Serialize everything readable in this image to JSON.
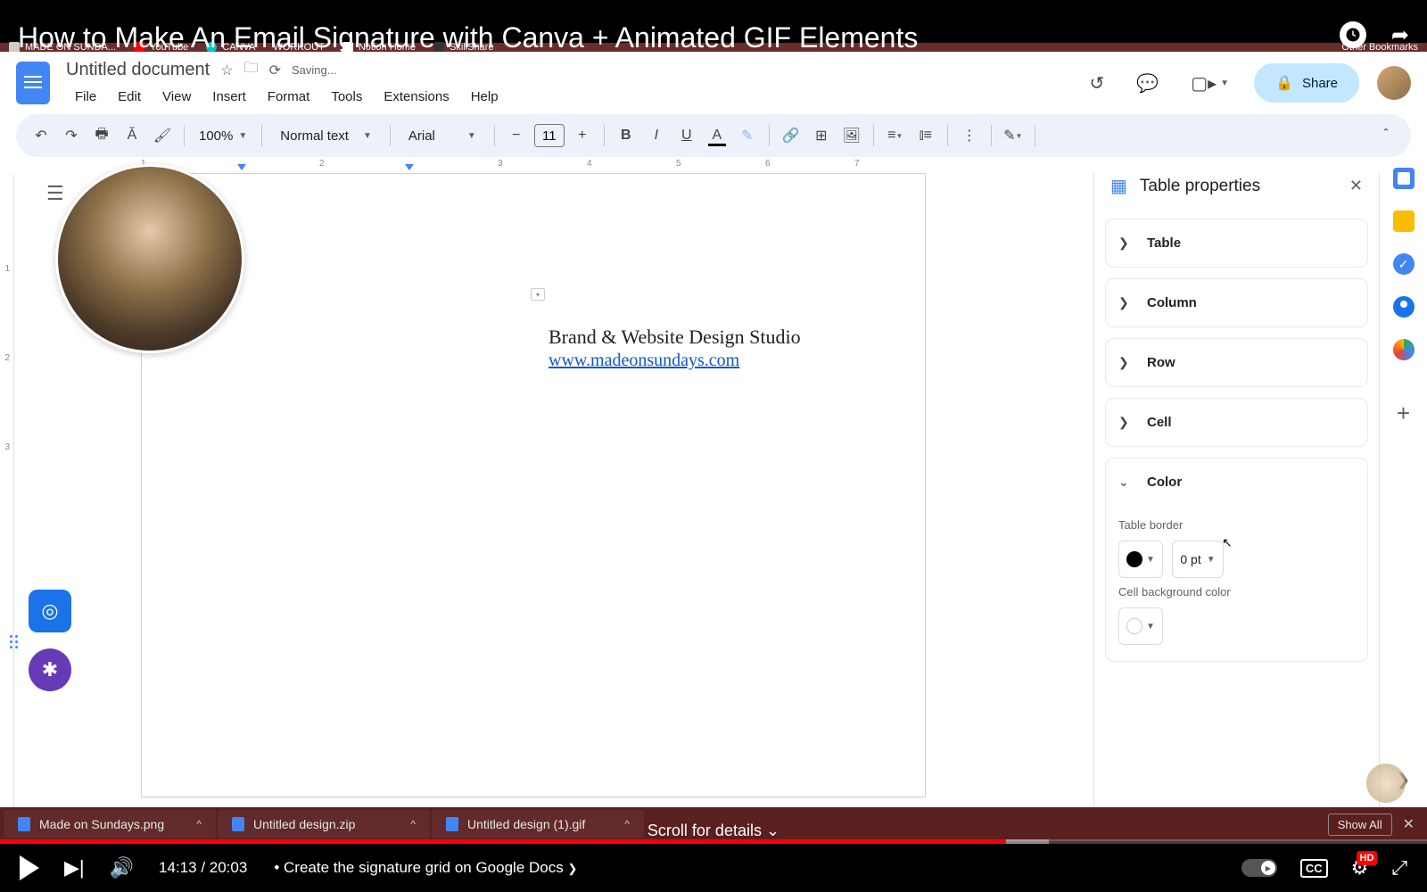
{
  "video": {
    "title": "How to Make An Email Signature with Canva + Animated GIF Elements",
    "current_time": "14:13",
    "duration": "20:03",
    "chapter": "Create the signature grid on Google Docs",
    "scroll_hint": "Scroll for details",
    "progress_percent": 70.5
  },
  "browser": {
    "tabs": [
      {
        "icon": "docs",
        "label": "MADE ON SUNDA..."
      },
      {
        "icon": "yt",
        "label": "YouTube"
      },
      {
        "icon": "canva",
        "label": "CANVA"
      },
      {
        "icon": "wo",
        "label": "WORKOUT"
      },
      {
        "icon": "notion",
        "label": "Notion Home"
      },
      {
        "icon": "sk",
        "label": "SkillShare"
      }
    ],
    "other_bookmarks": "Other Bookmarks"
  },
  "gdocs": {
    "doc_title": "Untitled document",
    "saving": "Saving...",
    "menus": [
      "File",
      "Edit",
      "View",
      "Insert",
      "Format",
      "Tools",
      "Extensions",
      "Help"
    ],
    "share_label": "Share",
    "toolbar": {
      "zoom": "100%",
      "style": "Normal text",
      "font": "Arial",
      "font_size": "11"
    },
    "ruler_h": [
      "1",
      "2",
      "3",
      "4",
      "5",
      "6",
      "7"
    ],
    "ruler_v": [
      "1",
      "2",
      "3"
    ],
    "signature": {
      "line1": "Brand & Website Design Studio",
      "link": "www.madeonsundays.com"
    }
  },
  "table_props": {
    "title": "Table properties",
    "sections": {
      "table": "Table",
      "column": "Column",
      "row": "Row",
      "cell": "Cell",
      "color": "Color"
    },
    "color": {
      "table_border_label": "Table border",
      "border_color": "#000000",
      "border_width": "0 pt",
      "cell_bg_label": "Cell background color",
      "cell_bg": "#ffffff"
    }
  },
  "downloads": {
    "items": [
      {
        "name": "Made on Sundays.png"
      },
      {
        "name": "Untitled design.zip"
      },
      {
        "name": "Untitled design (1).gif"
      }
    ],
    "show_all": "Show All"
  }
}
